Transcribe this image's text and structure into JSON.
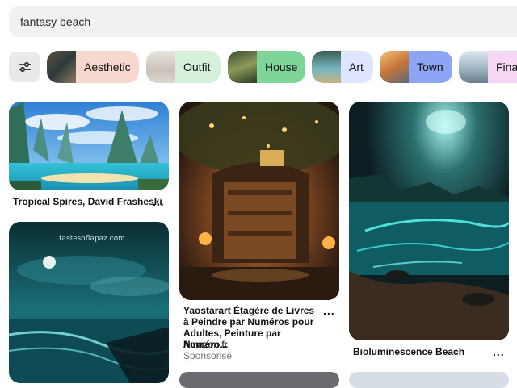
{
  "search": {
    "value": "fantasy beach"
  },
  "filter_chips": [
    {
      "label": "Aesthetic",
      "color": "#f7d8cf"
    },
    {
      "label": "Outfit",
      "color": "#d6f0dc"
    },
    {
      "label": "House",
      "color": "#7fd49a"
    },
    {
      "label": "Art",
      "color": "#dfe4ff"
    },
    {
      "label": "Town",
      "color": "#8ea4f4"
    },
    {
      "label": "Final",
      "color": "#f6d7f3"
    }
  ],
  "pins": [
    {
      "title": "Tropical Spires, David Frasheski",
      "more": "..."
    },
    {
      "title": "Yaostarart Étagère de Livres à Peindre par Numéros pour Adultes, Peinture par Numéro...",
      "source": "Amazon.fr",
      "sponsored": "Sponsorisé",
      "more": "..."
    },
    {
      "title": "Bioluminescence Beach",
      "more": "..."
    },
    {
      "watermark": "tastesoflapaz.com"
    }
  ]
}
